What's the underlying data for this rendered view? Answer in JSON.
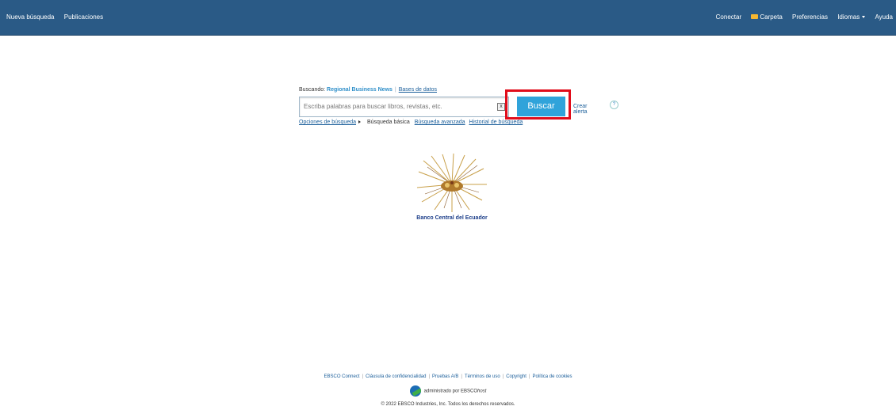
{
  "nav": {
    "left": [
      "Nueva búsqueda",
      "Publicaciones"
    ],
    "right": {
      "conectar": "Conectar",
      "carpeta": "Carpeta",
      "preferencias": "Preferencias",
      "idiomas": "Idiomas",
      "ayuda": "Ayuda"
    }
  },
  "search": {
    "searching_label": "Buscando:",
    "database": "Regional Business News",
    "databases_link": "Bases de datos",
    "placeholder": "Escriba palabras para buscar libros, revistas, etc.",
    "button": "Buscar",
    "create_alert": "Crear alerta",
    "help": "?",
    "clear": "x"
  },
  "options": {
    "search_options": "Opciones de búsqueda",
    "basic": "Búsqueda básica",
    "advanced": "Búsqueda avanzada",
    "history": "Historial de búsqueda"
  },
  "logo": {
    "caption": "Banco Central del Ecuador"
  },
  "footer": {
    "links": [
      "EBSCO Connect",
      "Cláusula de confidencialidad",
      "Pruebas A/B",
      "Términos de uso",
      "Copyright",
      "Política de cookies"
    ],
    "powered_prefix": "administrado por EBSCO",
    "powered_suffix": "host",
    "copyright": "© 2022 EBSCO Industries, Inc. Todos los derechos reservados."
  },
  "colors": {
    "topbar": "#2a5a86",
    "button": "#30a3da",
    "highlight": "#e10d1b"
  }
}
